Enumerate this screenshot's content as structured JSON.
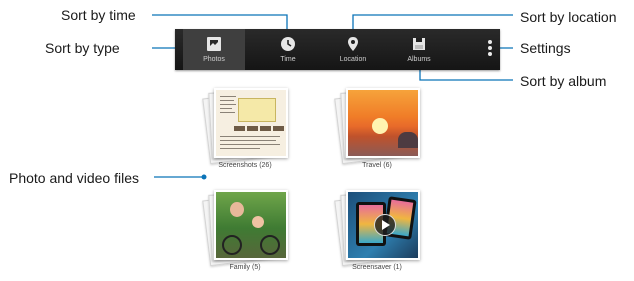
{
  "callouts": {
    "sort_by_time": "Sort by time",
    "sort_by_type": "Sort by type",
    "sort_by_location": "Sort by location",
    "settings": "Settings",
    "sort_by_album": "Sort by album",
    "photo_and_video_files": "Photo and video files"
  },
  "toolbar": {
    "tabs": [
      {
        "label": "Photos",
        "icon": "photos-icon",
        "selected": true
      },
      {
        "label": "Time",
        "icon": "clock-icon",
        "selected": false
      },
      {
        "label": "Location",
        "icon": "location-pin-icon",
        "selected": false
      },
      {
        "label": "Albums",
        "icon": "albums-icon",
        "selected": false
      }
    ],
    "overflow_icon": "overflow-menu-icon"
  },
  "albums": [
    {
      "caption": "Screenshots (26)"
    },
    {
      "caption": "Travel (6)"
    },
    {
      "caption": "Family (5)"
    },
    {
      "caption": "Screensaver (1)"
    }
  ],
  "colors": {
    "toolbar_bg": "#1e1e1e",
    "selected_tab_bg": "#3f3f3f",
    "callout_line": "#0a74b8"
  }
}
